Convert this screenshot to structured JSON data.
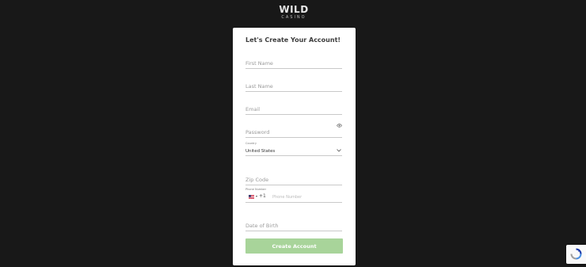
{
  "logo": {
    "main": "WILD",
    "sub": "CASINO"
  },
  "form": {
    "title": "Let's Create Your Account!",
    "first_name_placeholder": "First Name",
    "last_name_placeholder": "Last Name",
    "email_placeholder": "Email",
    "password_placeholder": "Password",
    "country_label": "Country",
    "country_value": "United States",
    "zip_placeholder": "Zip Code",
    "phone_label": "Phone Number",
    "dial_code": "+1",
    "phone_placeholder": "Phone Number",
    "dob_placeholder": "Date of Birth",
    "submit_label": "Create Account"
  },
  "icons": {
    "password_toggle": "eye-icon",
    "country_dropdown": "chevron-down-icon",
    "phone_country": "us-flag-icon",
    "captcha": "recaptcha-icon"
  },
  "colors": {
    "page_background": "#181818",
    "card_background": "#ffffff",
    "button_background": "#a8d49a",
    "logo_accent": "#6dbb3f"
  }
}
